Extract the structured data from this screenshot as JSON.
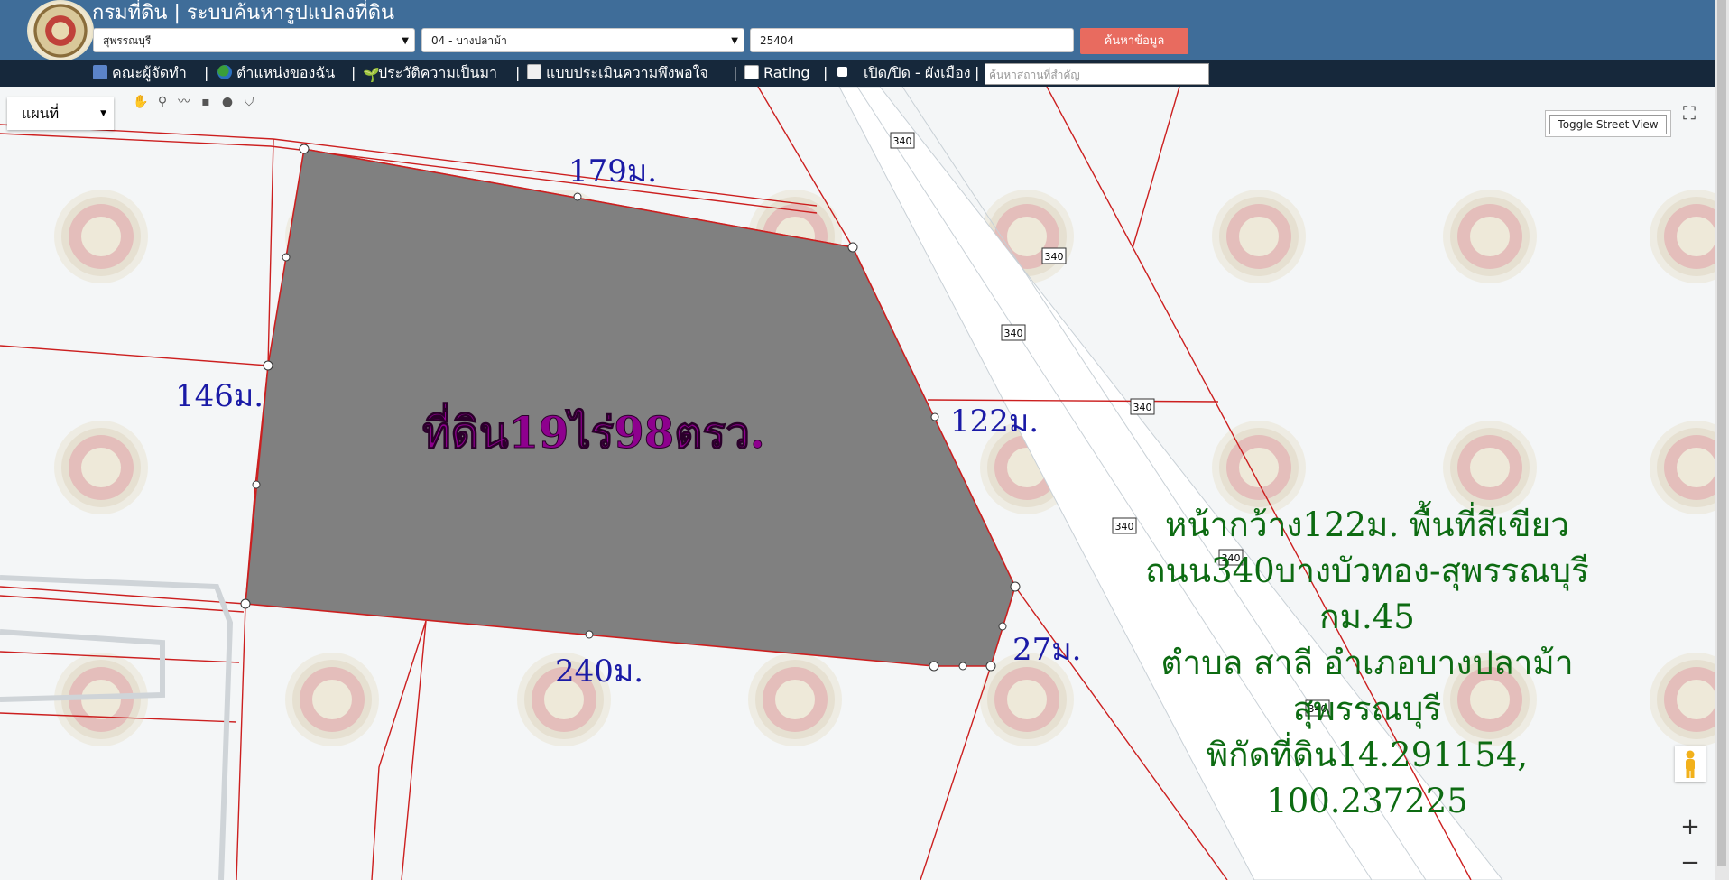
{
  "header": {
    "title": "กรมที่ดิน | ระบบค้นหารูปแปลงที่ดิน",
    "province": "สุพรรณบุรี",
    "district": "04 - บางปลาม้า",
    "parcel_no": "25404",
    "search_label": "ค้นหาข้อมูล"
  },
  "nav": {
    "items": [
      {
        "label": "คณะผู้จัดทำ",
        "icon": "gift-icon"
      },
      {
        "label": "ตำแหน่งของฉัน",
        "icon": "globe-icon"
      },
      {
        "label": "ประวัติความเป็นมา",
        "icon": "sprout-icon"
      },
      {
        "label": "แบบประเมินความพึงพอใจ",
        "icon": "note-icon"
      },
      {
        "label": "Rating",
        "icon": "chart-icon"
      },
      {
        "label": "เปิด/ปิด - ผังเมือง",
        "icon": "checkbox-icon"
      }
    ],
    "separator": "|",
    "place_search_placeholder": "ค้นหาสถานที่สำคัญ"
  },
  "map": {
    "type_label": "แผนที่",
    "toggle_street_view": "Toggle Street View",
    "zoom_in": "+",
    "zoom_out": "−",
    "road_number": "340",
    "parcel_label": "ที่ดิน19ไร่98ตรว.",
    "dims": {
      "top": "179ม.",
      "left": "146ม.",
      "right": "122ม.",
      "bottom": "240ม.",
      "corner": "27ม."
    },
    "annotation": [
      "หน้ากว้าง122ม. พื้นที่สีเขียว",
      "ถนน340บางบัวทอง-สุพรรณบุรี กม.45",
      "ตำบล สาลี อำเภอบางปลาม้า สุพรรณบุรี",
      "พิกัดที่ดิน14.291154, 100.237225"
    ],
    "colors": {
      "parcel_fill": "#808080",
      "boundary": "#cc1f1f",
      "dim_text": "#1a1aa6",
      "label_text": "#8e008e",
      "annotation_text": "#0d6b12"
    }
  }
}
